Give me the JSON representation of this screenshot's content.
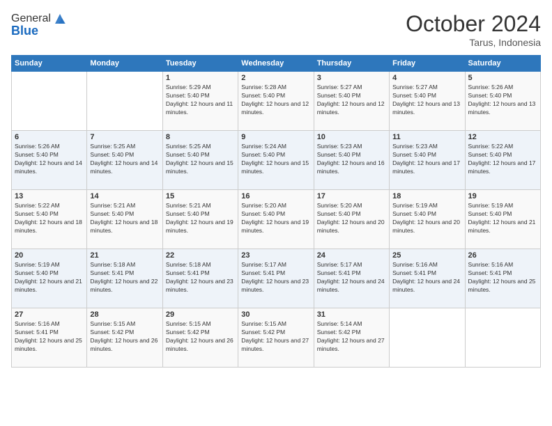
{
  "logo": {
    "general": "General",
    "blue": "Blue"
  },
  "header": {
    "month": "October 2024",
    "location": "Tarus, Indonesia"
  },
  "days_of_week": [
    "Sunday",
    "Monday",
    "Tuesday",
    "Wednesday",
    "Thursday",
    "Friday",
    "Saturday"
  ],
  "weeks": [
    [
      {
        "day": "",
        "sunrise": "",
        "sunset": "",
        "daylight": ""
      },
      {
        "day": "",
        "sunrise": "",
        "sunset": "",
        "daylight": ""
      },
      {
        "day": "1",
        "sunrise": "Sunrise: 5:29 AM",
        "sunset": "Sunset: 5:40 PM",
        "daylight": "Daylight: 12 hours and 11 minutes."
      },
      {
        "day": "2",
        "sunrise": "Sunrise: 5:28 AM",
        "sunset": "Sunset: 5:40 PM",
        "daylight": "Daylight: 12 hours and 12 minutes."
      },
      {
        "day": "3",
        "sunrise": "Sunrise: 5:27 AM",
        "sunset": "Sunset: 5:40 PM",
        "daylight": "Daylight: 12 hours and 12 minutes."
      },
      {
        "day": "4",
        "sunrise": "Sunrise: 5:27 AM",
        "sunset": "Sunset: 5:40 PM",
        "daylight": "Daylight: 12 hours and 13 minutes."
      },
      {
        "day": "5",
        "sunrise": "Sunrise: 5:26 AM",
        "sunset": "Sunset: 5:40 PM",
        "daylight": "Daylight: 12 hours and 13 minutes."
      }
    ],
    [
      {
        "day": "6",
        "sunrise": "Sunrise: 5:26 AM",
        "sunset": "Sunset: 5:40 PM",
        "daylight": "Daylight: 12 hours and 14 minutes."
      },
      {
        "day": "7",
        "sunrise": "Sunrise: 5:25 AM",
        "sunset": "Sunset: 5:40 PM",
        "daylight": "Daylight: 12 hours and 14 minutes."
      },
      {
        "day": "8",
        "sunrise": "Sunrise: 5:25 AM",
        "sunset": "Sunset: 5:40 PM",
        "daylight": "Daylight: 12 hours and 15 minutes."
      },
      {
        "day": "9",
        "sunrise": "Sunrise: 5:24 AM",
        "sunset": "Sunset: 5:40 PM",
        "daylight": "Daylight: 12 hours and 15 minutes."
      },
      {
        "day": "10",
        "sunrise": "Sunrise: 5:23 AM",
        "sunset": "Sunset: 5:40 PM",
        "daylight": "Daylight: 12 hours and 16 minutes."
      },
      {
        "day": "11",
        "sunrise": "Sunrise: 5:23 AM",
        "sunset": "Sunset: 5:40 PM",
        "daylight": "Daylight: 12 hours and 17 minutes."
      },
      {
        "day": "12",
        "sunrise": "Sunrise: 5:22 AM",
        "sunset": "Sunset: 5:40 PM",
        "daylight": "Daylight: 12 hours and 17 minutes."
      }
    ],
    [
      {
        "day": "13",
        "sunrise": "Sunrise: 5:22 AM",
        "sunset": "Sunset: 5:40 PM",
        "daylight": "Daylight: 12 hours and 18 minutes."
      },
      {
        "day": "14",
        "sunrise": "Sunrise: 5:21 AM",
        "sunset": "Sunset: 5:40 PM",
        "daylight": "Daylight: 12 hours and 18 minutes."
      },
      {
        "day": "15",
        "sunrise": "Sunrise: 5:21 AM",
        "sunset": "Sunset: 5:40 PM",
        "daylight": "Daylight: 12 hours and 19 minutes."
      },
      {
        "day": "16",
        "sunrise": "Sunrise: 5:20 AM",
        "sunset": "Sunset: 5:40 PM",
        "daylight": "Daylight: 12 hours and 19 minutes."
      },
      {
        "day": "17",
        "sunrise": "Sunrise: 5:20 AM",
        "sunset": "Sunset: 5:40 PM",
        "daylight": "Daylight: 12 hours and 20 minutes."
      },
      {
        "day": "18",
        "sunrise": "Sunrise: 5:19 AM",
        "sunset": "Sunset: 5:40 PM",
        "daylight": "Daylight: 12 hours and 20 minutes."
      },
      {
        "day": "19",
        "sunrise": "Sunrise: 5:19 AM",
        "sunset": "Sunset: 5:40 PM",
        "daylight": "Daylight: 12 hours and 21 minutes."
      }
    ],
    [
      {
        "day": "20",
        "sunrise": "Sunrise: 5:19 AM",
        "sunset": "Sunset: 5:40 PM",
        "daylight": "Daylight: 12 hours and 21 minutes."
      },
      {
        "day": "21",
        "sunrise": "Sunrise: 5:18 AM",
        "sunset": "Sunset: 5:41 PM",
        "daylight": "Daylight: 12 hours and 22 minutes."
      },
      {
        "day": "22",
        "sunrise": "Sunrise: 5:18 AM",
        "sunset": "Sunset: 5:41 PM",
        "daylight": "Daylight: 12 hours and 23 minutes."
      },
      {
        "day": "23",
        "sunrise": "Sunrise: 5:17 AM",
        "sunset": "Sunset: 5:41 PM",
        "daylight": "Daylight: 12 hours and 23 minutes."
      },
      {
        "day": "24",
        "sunrise": "Sunrise: 5:17 AM",
        "sunset": "Sunset: 5:41 PM",
        "daylight": "Daylight: 12 hours and 24 minutes."
      },
      {
        "day": "25",
        "sunrise": "Sunrise: 5:16 AM",
        "sunset": "Sunset: 5:41 PM",
        "daylight": "Daylight: 12 hours and 24 minutes."
      },
      {
        "day": "26",
        "sunrise": "Sunrise: 5:16 AM",
        "sunset": "Sunset: 5:41 PM",
        "daylight": "Daylight: 12 hours and 25 minutes."
      }
    ],
    [
      {
        "day": "27",
        "sunrise": "Sunrise: 5:16 AM",
        "sunset": "Sunset: 5:41 PM",
        "daylight": "Daylight: 12 hours and 25 minutes."
      },
      {
        "day": "28",
        "sunrise": "Sunrise: 5:15 AM",
        "sunset": "Sunset: 5:42 PM",
        "daylight": "Daylight: 12 hours and 26 minutes."
      },
      {
        "day": "29",
        "sunrise": "Sunrise: 5:15 AM",
        "sunset": "Sunset: 5:42 PM",
        "daylight": "Daylight: 12 hours and 26 minutes."
      },
      {
        "day": "30",
        "sunrise": "Sunrise: 5:15 AM",
        "sunset": "Sunset: 5:42 PM",
        "daylight": "Daylight: 12 hours and 27 minutes."
      },
      {
        "day": "31",
        "sunrise": "Sunrise: 5:14 AM",
        "sunset": "Sunset: 5:42 PM",
        "daylight": "Daylight: 12 hours and 27 minutes."
      },
      {
        "day": "",
        "sunrise": "",
        "sunset": "",
        "daylight": ""
      },
      {
        "day": "",
        "sunrise": "",
        "sunset": "",
        "daylight": ""
      }
    ]
  ]
}
